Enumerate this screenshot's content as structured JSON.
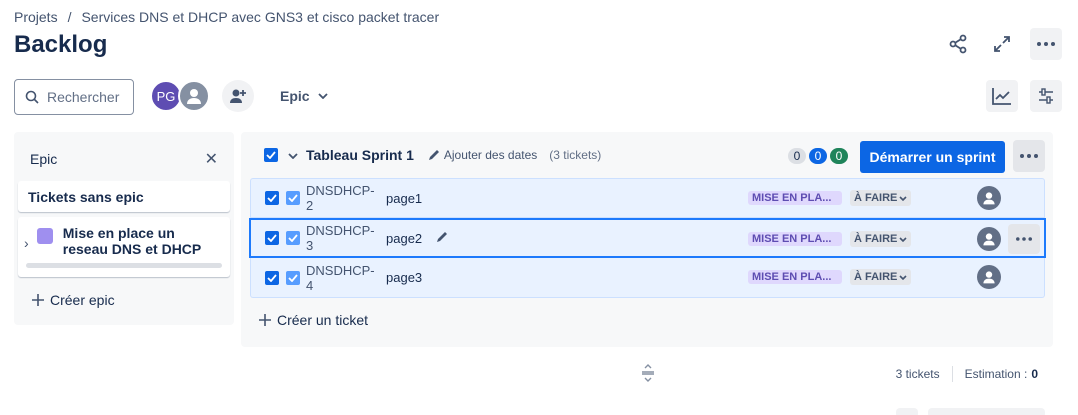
{
  "breadcrumb": {
    "root": "Projets",
    "separator": "/",
    "project": "Services DNS et DHCP avec GNS3 et cisco packet tracer"
  },
  "page": {
    "title": "Backlog"
  },
  "search": {
    "placeholder": "Rechercher"
  },
  "avatars": {
    "first_initials": "PG"
  },
  "filters": {
    "epic_label": "Epic"
  },
  "epic_panel": {
    "title": "Epic",
    "no_epic_label": "Tickets sans epic",
    "epic_name": "Mise en place un reseau DNS et DHCP",
    "epic_color": "#9f8fef",
    "create_label": "Créer epic"
  },
  "sprint": {
    "name": "Tableau Sprint 1",
    "add_dates": "Ajouter des dates",
    "ticket_count": "(3 tickets)",
    "counts": {
      "todo": "0",
      "in_progress": "0",
      "done": "0"
    },
    "start_button": "Démarrer un sprint",
    "issues": [
      {
        "key": "DNSDHCP-2",
        "summary": "page1",
        "epic": "MISE EN PLA...",
        "status": "À FAIRE"
      },
      {
        "key": "DNSDHCP-3",
        "summary": "page2",
        "epic": "MISE EN PLA...",
        "status": "À FAIRE"
      },
      {
        "key": "DNSDHCP-4",
        "summary": "page3",
        "epic": "MISE EN PLA...",
        "status": "À FAIRE"
      }
    ],
    "create_ticket": "Créer un ticket"
  },
  "footer": {
    "tickets": "3 tickets",
    "estimate_label": "Estimation :",
    "estimate_value": "0"
  },
  "colors": {
    "primary": "#0c66e4",
    "row_bg": "#e9f2ff",
    "epic_lozenge": "#dfd8fd"
  }
}
